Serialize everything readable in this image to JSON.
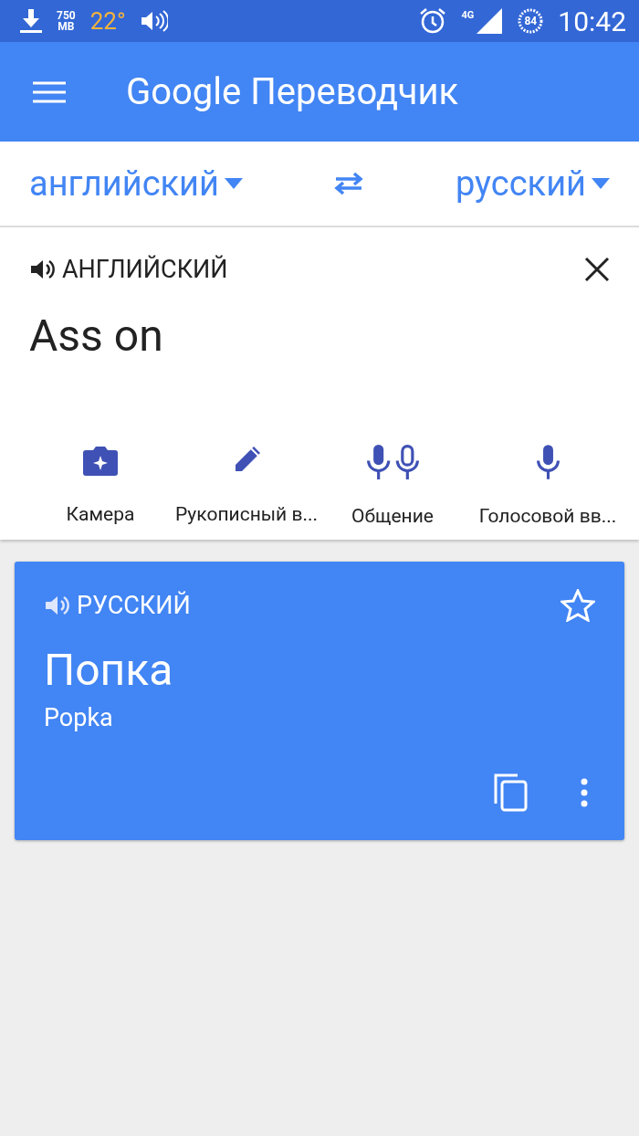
{
  "status_bar": {
    "memory_value": "750",
    "memory_unit": "MB",
    "temperature": "22°",
    "network": "4G",
    "battery": "84",
    "time": "10:42"
  },
  "app_bar": {
    "title_brand": "Google",
    "title": "Переводчик"
  },
  "languages": {
    "source": "английский",
    "target": "русский"
  },
  "input": {
    "language_label": "АНГЛИЙСКИЙ",
    "text": "Ass on"
  },
  "tools": [
    {
      "kind": "camera",
      "label": "Камера"
    },
    {
      "kind": "pen",
      "label": "Рукописный в..."
    },
    {
      "kind": "conversation",
      "label": "Общение"
    },
    {
      "kind": "voice",
      "label": "Голосовой вв..."
    }
  ],
  "result": {
    "language_label": "РУССКИЙ",
    "translation": "Попка",
    "transliteration": "Popka",
    "starred": false
  }
}
